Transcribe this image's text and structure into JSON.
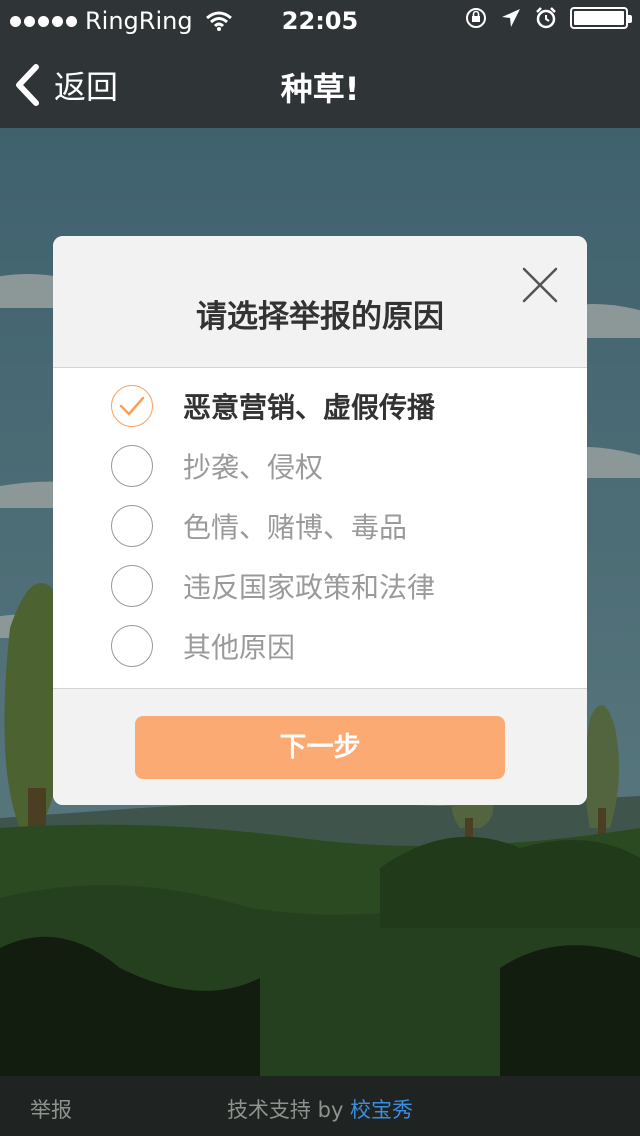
{
  "status_bar": {
    "carrier": "RingRing",
    "time": "22:05",
    "icons": [
      "signal-dots-icon",
      "wifi-icon",
      "rotation-lock-icon",
      "location-icon",
      "alarm-icon",
      "battery-icon"
    ]
  },
  "nav": {
    "back_label": "返回",
    "title": "种草!"
  },
  "dialog": {
    "title": "请选择举报的原因",
    "options": [
      {
        "label": "恶意营销、虚假传播",
        "checked": true
      },
      {
        "label": "抄袭、侵权",
        "checked": false
      },
      {
        "label": "色情、赌博、毒品",
        "checked": false
      },
      {
        "label": "违反国家政策和法律",
        "checked": false
      },
      {
        "label": "其他原因",
        "checked": false
      }
    ],
    "next_button": "下一步"
  },
  "footer": {
    "report_label": "举报",
    "credit_prefix": "技术支持 by ",
    "credit_brand": "校宝秀"
  },
  "colors": {
    "accent": "#fbaa73",
    "check": "#f7a15c",
    "bar": "#2f3436",
    "brand_link": "#3b8de0"
  }
}
